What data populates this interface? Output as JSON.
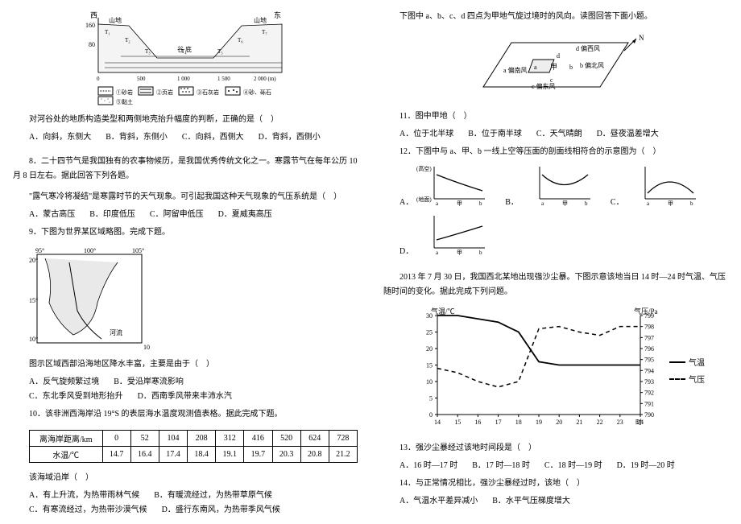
{
  "left": {
    "valley_fig": {
      "west": "西",
      "east": "东",
      "land_left": "山地",
      "land_right": "山地",
      "valley": "谷 底",
      "y_top": "160",
      "y_mid": "80",
      "t_labels": [
        "T₁",
        "T₂",
        "T₃",
        "T₄",
        "T₅",
        "T₆",
        "T₇"
      ],
      "x_ticks": [
        "0",
        "500",
        "1 000",
        "1 500",
        "2 000 (m)"
      ],
      "legend": [
        "①砂岩",
        "②页岩",
        "③石灰岩",
        "④砂、砾石",
        "⑤黏土"
      ]
    },
    "q7_stem": "对河谷处的地质构造类型和两侧地壳抬升幅度的判断，正确的是（　）",
    "q7_opts": [
      "A．向斜，东侧大",
      "B．背斜，东侧小",
      "C．向斜，西侧大",
      "D．背斜，西侧小"
    ],
    "q8_intro": "8．二十四节气是我国独有的农事物候历，是我国优秀传统文化之一。寒露节气在每年公历 10 月 8 日左右。据此回答下列各题。",
    "q8_stem": "\"露气寒冷将凝结\"是寒露时节的天气现象。可引起我国这种天气现象的气压系统是（　）",
    "q8_opts": [
      "A．蒙古高压",
      "B．印度低压",
      "C．阿留申低压",
      "D．夏威夷高压"
    ],
    "q9_stem": "9．下图为世界某区域略图。完成下题。",
    "map_fig": {
      "lon1": "95°",
      "lon2": "100°",
      "lon3": "105°",
      "lat1": "20°",
      "lat2": "15°",
      "lat3": "10°",
      "river": "河流"
    },
    "q9_sub": "图示区域西部沿海地区降水丰富，主要是由于（　）",
    "q9_opts": [
      "A．反气旋频繁过境",
      "B．受沿岸寒流影响",
      "C．东北季风受到地形抬升",
      "D．西南季风带来丰沛水汽"
    ],
    "q10_stem": "10．该非洲西海岸沿 19°S 的表层海水温度观测值表格。据此完成下题。",
    "q10_table": {
      "r1": [
        "离海岸距离/km",
        "0",
        "52",
        "104",
        "208",
        "312",
        "416",
        "520",
        "624",
        "728"
      ],
      "r2": [
        "水温/℃",
        "14.7",
        "16.4",
        "17.4",
        "18.4",
        "19.1",
        "19.7",
        "20.3",
        "20.8",
        "21.2"
      ]
    },
    "q10_sub": "该海域沿岸（　）",
    "q10_opts": [
      "A．有上升流，为热带雨林气候",
      "B．有暖流经过，为热带草原气候",
      "C．有寒流经过，为热带沙漠气候",
      "D．盛行东南风，为热带季风气候"
    ]
  },
  "right": {
    "intro": "下图中 a、b、c、d 四点为甲地气旋过境时的风向。读图回答下面小题。",
    "wind_fig": {
      "center": "甲",
      "a_lbl": "a",
      "b_lbl": "b",
      "c_lbl": "c",
      "d_lbl": "d",
      "w_pnw": "d 偏西风",
      "w_pn": "b 偏北风",
      "w_ps": "a 偏南风",
      "w_pe": "c 偏东风",
      "arrow_lbl": "N"
    },
    "q11_stem": "11．图中甲地（　）",
    "q11_opts": [
      "A．位于北半球",
      "B．位于南半球",
      "C．天气晴朗",
      "D．昼夜温差增大"
    ],
    "q12_stem": "12．下图中与 a、甲、b 一线上空等压面的剖面线相符合的示意图为（　）",
    "mini_labels": {
      "hi": "(高空)",
      "lo": "(地面)"
    },
    "mini_tags": {
      "A": "A．",
      "B": "B．",
      "C": "C．",
      "D": "D．"
    },
    "mini_xticks": {
      "a": "a",
      "mid": "甲",
      "b": "b"
    },
    "dust_intro": "2013 年 7 月 30 日，我国西北某地出现强沙尘暴。下图示意该地当日 14 时—24 时气温、气压随时间的变化。据此完成下列问题。",
    "chart": {
      "y1_label": "气温/℃",
      "y2_label": "气压/Pa",
      "legend_temp": "气温",
      "legend_pres": "气压"
    },
    "q13_stem": "13．强沙尘暴经过该地时间段是（　）",
    "q13_opts": [
      "A．16 时—17 时",
      "B．17 时—18 时",
      "C．18 时—19 时",
      "D．19 时—20 时"
    ],
    "q14_stem": "14．与正常情况相比，强沙尘暴经过时，该地（　）",
    "q14_opts": [
      "A．气温水平差异减小",
      "B．水平气压梯度增大"
    ]
  },
  "chart_data": {
    "type": "line",
    "x": [
      14,
      15,
      16,
      17,
      18,
      19,
      20,
      21,
      22,
      23,
      24
    ],
    "series": [
      {
        "name": "气温",
        "axis": "left",
        "values": [
          30,
          30,
          29,
          28,
          25,
          16,
          15,
          15,
          15,
          15,
          15
        ]
      },
      {
        "name": "气压",
        "axis": "right",
        "values": [
          794.2,
          793.8,
          793.0,
          792.5,
          793.0,
          797.8,
          798.0,
          797.5,
          797.2,
          798.0,
          798.0
        ]
      }
    ],
    "xlabel": "时",
    "y1label": "气温/℃",
    "y2label": "气压/Pa",
    "y1lim": [
      0,
      30
    ],
    "y2lim": [
      790,
      799
    ],
    "y1ticks": [
      0,
      5,
      10,
      15,
      20,
      25,
      30
    ],
    "y2ticks": [
      790,
      791,
      792,
      793,
      794,
      795,
      796,
      797,
      798,
      799
    ]
  }
}
